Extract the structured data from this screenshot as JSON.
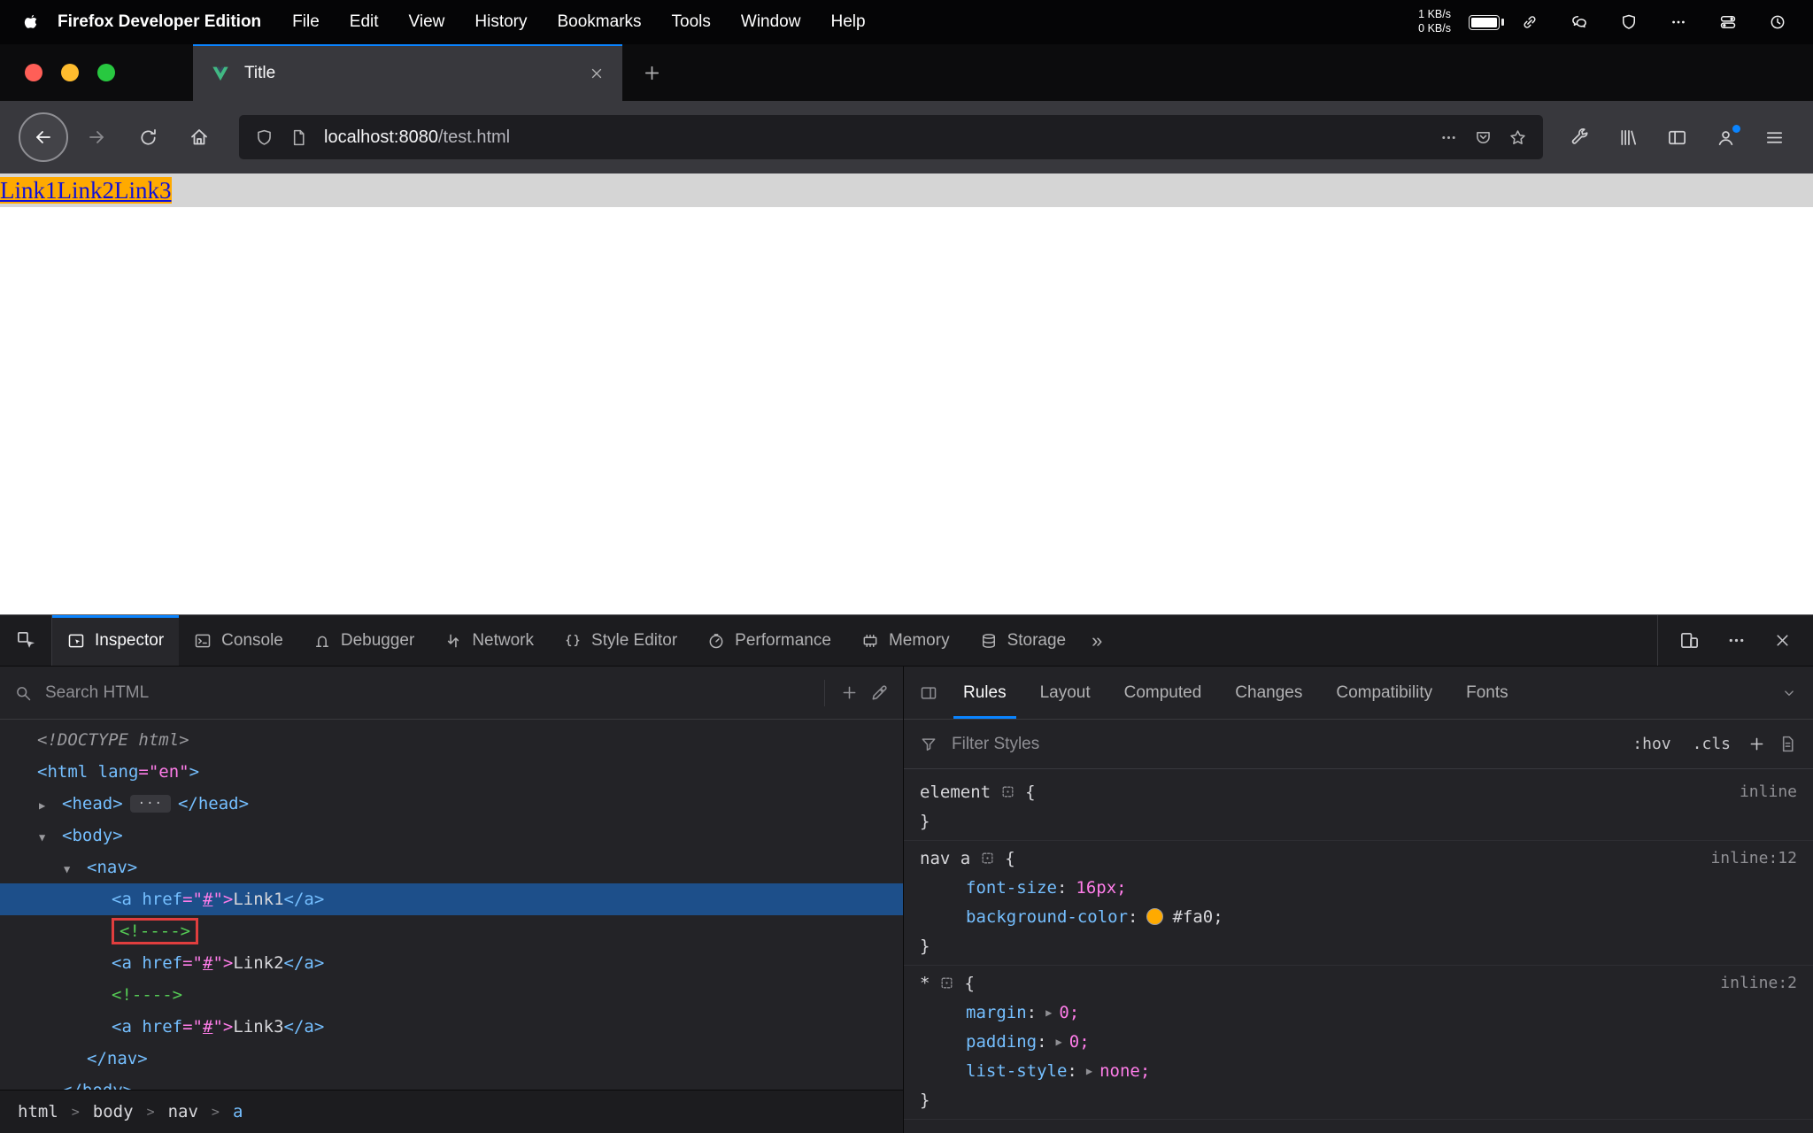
{
  "colors": {
    "accent": "#0a84ff",
    "selection": "#1d4f8a",
    "tag": "#75bfff",
    "value": "#ff7de9",
    "comment": "#55cb55",
    "link_blue": "#0f10d8",
    "link_bg": "#ffaa00",
    "annotation_red": "#e03e3e",
    "traffic_red": "#ff5f57",
    "traffic_yellow": "#febc2e",
    "traffic_green": "#28c840"
  },
  "menubar": {
    "app_name": "Firefox Developer Edition",
    "menus": [
      "File",
      "Edit",
      "View",
      "History",
      "Bookmarks",
      "Tools",
      "Window",
      "Help"
    ],
    "net_up": "1 KB/s",
    "net_down": "0 KB/s",
    "status_icons": [
      "link-icon",
      "wechat-icon",
      "shield-icon",
      "ellipsis-icon",
      "control-center-icon",
      "clock-icon"
    ]
  },
  "browser": {
    "tab_title": "Title",
    "url_host": "localhost:8080",
    "url_path": "/test.html"
  },
  "page": {
    "links": [
      "Link1",
      "Link2",
      "Link3"
    ]
  },
  "devtools": {
    "tabs": [
      {
        "label": "Inspector",
        "icon": "inspector-icon"
      },
      {
        "label": "Console",
        "icon": "console-icon"
      },
      {
        "label": "Debugger",
        "icon": "debugger-icon"
      },
      {
        "label": "Network",
        "icon": "network-icon"
      },
      {
        "label": "Style Editor",
        "icon": "style-editor-icon"
      },
      {
        "label": "Performance",
        "icon": "performance-icon"
      },
      {
        "label": "Memory",
        "icon": "memory-icon"
      },
      {
        "label": "Storage",
        "icon": "storage-icon"
      }
    ],
    "active_tab": "Inspector",
    "search_placeholder": "Search HTML",
    "markup_rows": [
      {
        "indent": 0,
        "twisty": "",
        "tokens": [
          {
            "c": "doctype",
            "s": "<!DOCTYPE html>"
          }
        ]
      },
      {
        "indent": 0,
        "twisty": "",
        "tokens": [
          {
            "c": "tag",
            "s": "<html"
          },
          {
            "c": "attr",
            "s": " lang"
          },
          {
            "c": "val",
            "s": "=\"en\""
          },
          {
            "c": "tag",
            "s": ">"
          }
        ]
      },
      {
        "indent": 1,
        "twisty": "collapsed",
        "tokens": [
          {
            "c": "tag",
            "s": "<head>"
          },
          {
            "c": "pill",
            "s": "···"
          },
          {
            "c": "tag",
            "s": "</head>"
          }
        ]
      },
      {
        "indent": 1,
        "twisty": "expanded",
        "tokens": [
          {
            "c": "tag",
            "s": "<body>"
          }
        ]
      },
      {
        "indent": 2,
        "twisty": "expanded",
        "tokens": [
          {
            "c": "tag",
            "s": "<nav>"
          }
        ]
      },
      {
        "indent": 3,
        "twisty": "",
        "selected": true,
        "tokens": [
          {
            "c": "tag",
            "s": "<a"
          },
          {
            "c": "attr",
            "s": " href"
          },
          {
            "c": "val",
            "s": "=\""
          },
          {
            "c": "vallink",
            "s": "#"
          },
          {
            "c": "val",
            "s": "\">"
          },
          {
            "c": "text",
            "s": "Link1"
          },
          {
            "c": "tag",
            "s": "</a>"
          }
        ]
      },
      {
        "indent": 3,
        "twisty": "",
        "annotated": true,
        "tokens": [
          {
            "c": "comment",
            "s": "<!---->"
          }
        ]
      },
      {
        "indent": 3,
        "twisty": "",
        "tokens": [
          {
            "c": "tag",
            "s": "<a"
          },
          {
            "c": "attr",
            "s": " href"
          },
          {
            "c": "val",
            "s": "=\""
          },
          {
            "c": "vallink",
            "s": "#"
          },
          {
            "c": "val",
            "s": "\">"
          },
          {
            "c": "text",
            "s": "Link2"
          },
          {
            "c": "tag",
            "s": "</a>"
          }
        ]
      },
      {
        "indent": 3,
        "twisty": "",
        "tokens": [
          {
            "c": "comment",
            "s": "<!---->"
          }
        ]
      },
      {
        "indent": 3,
        "twisty": "",
        "tokens": [
          {
            "c": "tag",
            "s": "<a"
          },
          {
            "c": "attr",
            "s": " href"
          },
          {
            "c": "val",
            "s": "=\""
          },
          {
            "c": "vallink",
            "s": "#"
          },
          {
            "c": "val",
            "s": "\">"
          },
          {
            "c": "text",
            "s": "Link3"
          },
          {
            "c": "tag",
            "s": "</a>"
          }
        ]
      },
      {
        "indent": 2,
        "twisty": "",
        "tokens": [
          {
            "c": "tag",
            "s": "</nav>"
          }
        ]
      },
      {
        "indent": 1,
        "twisty": "",
        "tokens": [
          {
            "c": "tag",
            "s": "</body>"
          }
        ]
      }
    ],
    "breadcrumbs": [
      "html",
      "body",
      "nav",
      "a"
    ],
    "breadcrumb_active": "a",
    "sidebar_tabs": [
      "Rules",
      "Layout",
      "Computed",
      "Changes",
      "Compatibility",
      "Fonts"
    ],
    "active_sidebar_tab": "Rules",
    "filter_placeholder": "Filter Styles",
    "pseudo_class_button": ":hov",
    "class_button": ".cls",
    "rules": [
      {
        "selector": "element",
        "source": "inline",
        "decls": []
      },
      {
        "selector": "nav a",
        "source": "inline:12",
        "decls": [
          {
            "name": "font-size",
            "value": "16px"
          },
          {
            "name": "background-color",
            "value": "#fa0",
            "swatch": "#ffaa00",
            "plain": true
          }
        ]
      },
      {
        "selector": "*",
        "source": "inline:2",
        "decls": [
          {
            "name": "margin",
            "value": "0",
            "expandable": true
          },
          {
            "name": "padding",
            "value": "0",
            "expandable": true
          },
          {
            "name": "list-style",
            "value": "none",
            "expandable": true
          }
        ]
      }
    ]
  }
}
